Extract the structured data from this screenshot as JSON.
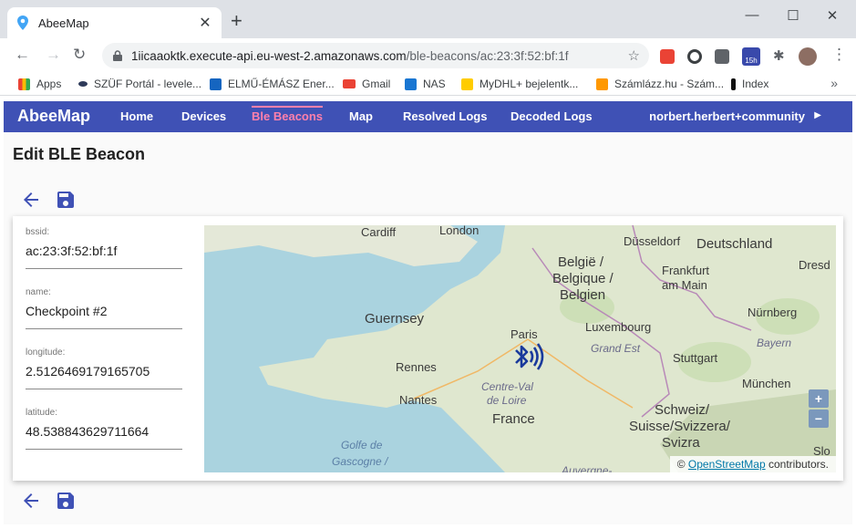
{
  "browser": {
    "tab_title": "AbeeMap",
    "url_host": "1iicaaoktk.execute-api.eu-west-2.amazonaws.com",
    "url_path": "/ble-beacons/ac:23:3f:52:bf:1f",
    "bookmarks": [
      "Apps",
      "SZÜF Portál - levele...",
      "ELMŰ-ÉMÁSZ Ener...",
      "Gmail",
      "NAS",
      "MyDHL+ bejelentk...",
      "Számlázz.hu - Szám...",
      "Index"
    ],
    "ext_badge": "15h"
  },
  "nav": {
    "brand": "AbeeMap",
    "links": [
      "Home",
      "Devices",
      "Ble Beacons",
      "Map",
      "Resolved Logs",
      "Decoded Logs"
    ],
    "active": "Ble Beacons",
    "user": "norbert.herbert+community"
  },
  "page": {
    "title": "Edit BLE Beacon"
  },
  "form": {
    "bssid_label": "bssid:",
    "bssid_value": "ac:23:3f:52:bf:1f",
    "name_label": "name:",
    "name_value": "Checkpoint #2",
    "longitude_label": "longitude:",
    "longitude_value": "2.5126469179165705",
    "latitude_label": "latitude:",
    "latitude_value": "48.538843629711664"
  },
  "map": {
    "labels": {
      "cardiff": "Cardiff",
      "london": "London",
      "dusseldorf": "Düsseldorf",
      "deutschland": "Deutschland",
      "dresden": "Dresd",
      "belgie1": "België /",
      "belgie2": "Belgique /",
      "belgie3": "Belgien",
      "frankfurt1": "Frankfurt",
      "frankfurt2": "am Main",
      "guernsey": "Guernsey",
      "paris": "Paris",
      "luxembourg": "Luxembourg",
      "nurnberg": "Nürnberg",
      "grandest": "Grand Est",
      "bayern": "Bayern",
      "rennes": "Rennes",
      "stuttgart": "Stuttgart",
      "centre1": "Centre-Val",
      "centre2": "de Loire",
      "nantes": "Nantes",
      "munchen": "München",
      "france": "France",
      "schweiz1": "Schweiz/",
      "schweiz2": "Suisse/Svizzera/",
      "schweiz3": "Svizra",
      "golfe1": "Golfe de",
      "golfe2": "Gascogne /",
      "auvergne": "Auvergne-",
      "slo": "Slo"
    },
    "zoom_in": "+",
    "zoom_out": "−",
    "attrib_prefix": "©",
    "attrib_link": "OpenStreetMap",
    "attrib_suffix": "contributors."
  }
}
